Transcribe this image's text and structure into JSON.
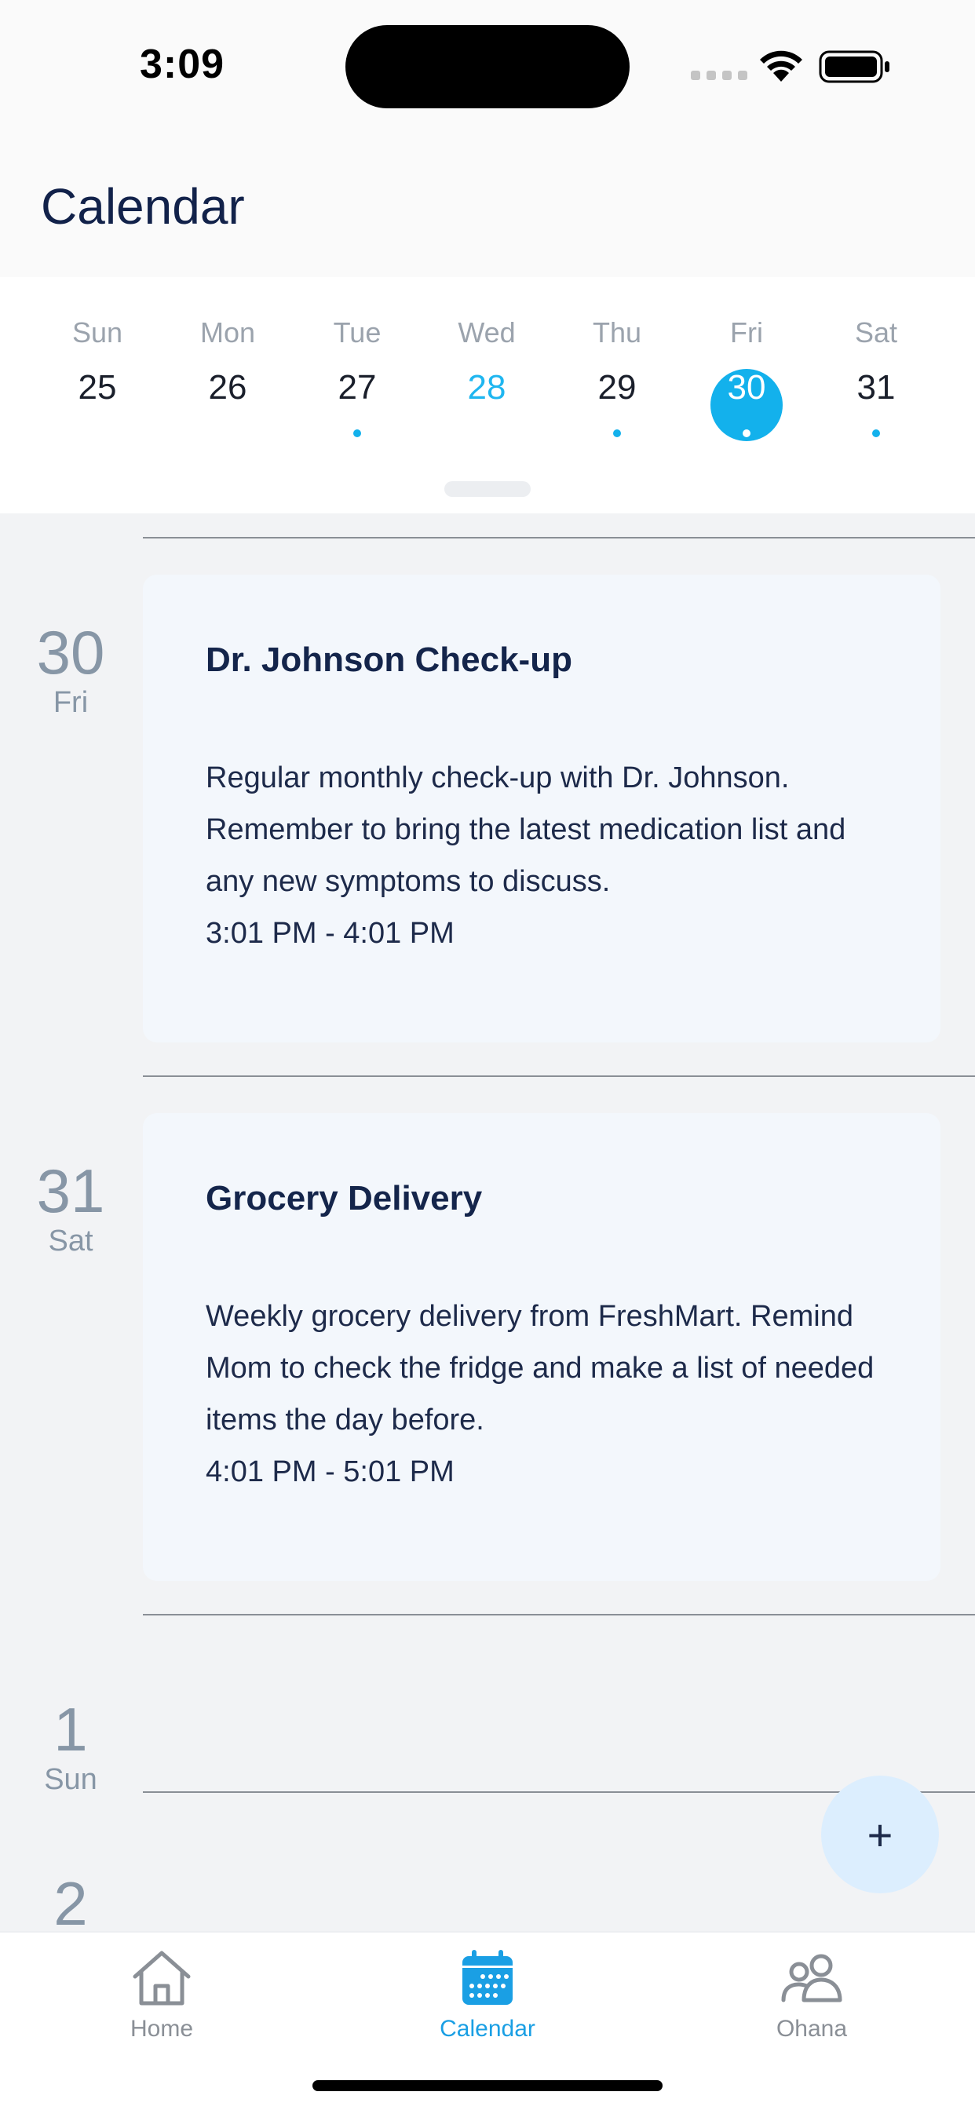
{
  "status_bar": {
    "time": "3:09"
  },
  "header": {
    "title": "Calendar"
  },
  "week": {
    "days": [
      {
        "name": "Sun",
        "num": "25",
        "has_event": false,
        "state": "normal"
      },
      {
        "name": "Mon",
        "num": "26",
        "has_event": false,
        "state": "normal"
      },
      {
        "name": "Tue",
        "num": "27",
        "has_event": true,
        "state": "normal"
      },
      {
        "name": "Wed",
        "num": "28",
        "has_event": false,
        "state": "today"
      },
      {
        "name": "Thu",
        "num": "29",
        "has_event": true,
        "state": "normal"
      },
      {
        "name": "Fri",
        "num": "30",
        "has_event": true,
        "state": "selected"
      },
      {
        "name": "Sat",
        "num": "31",
        "has_event": true,
        "state": "normal"
      }
    ]
  },
  "agenda": {
    "days": [
      {
        "num": "30",
        "weekday": "Fri",
        "event": {
          "title": "Dr. Johnson Check-up",
          "description": "Regular monthly check-up with Dr. Johnson. Remember to bring the latest medication list and any new symptoms to discuss.",
          "time": "3:01 PM - 4:01 PM"
        }
      },
      {
        "num": "31",
        "weekday": "Sat",
        "event": {
          "title": "Grocery Delivery",
          "description": "Weekly grocery delivery from FreshMart. Remind Mom to check the fridge and make a list of needed items the day before.",
          "time": "4:01 PM - 5:01 PM"
        }
      },
      {
        "num": "1",
        "weekday": "Sun"
      },
      {
        "num": "2",
        "weekday": ""
      }
    ]
  },
  "fab": {
    "label": "+",
    "icon": "plus-icon"
  },
  "tabs": [
    {
      "label": "Home",
      "icon": "home-icon",
      "active": false
    },
    {
      "label": "Calendar",
      "icon": "calendar-icon",
      "active": true
    },
    {
      "label": "Ohana",
      "icon": "people-icon",
      "active": false
    }
  ],
  "colors": {
    "accent": "#13b1ec",
    "tab_active": "#1a9fe4",
    "text": "#12224a",
    "card": "#f3f7fc"
  }
}
